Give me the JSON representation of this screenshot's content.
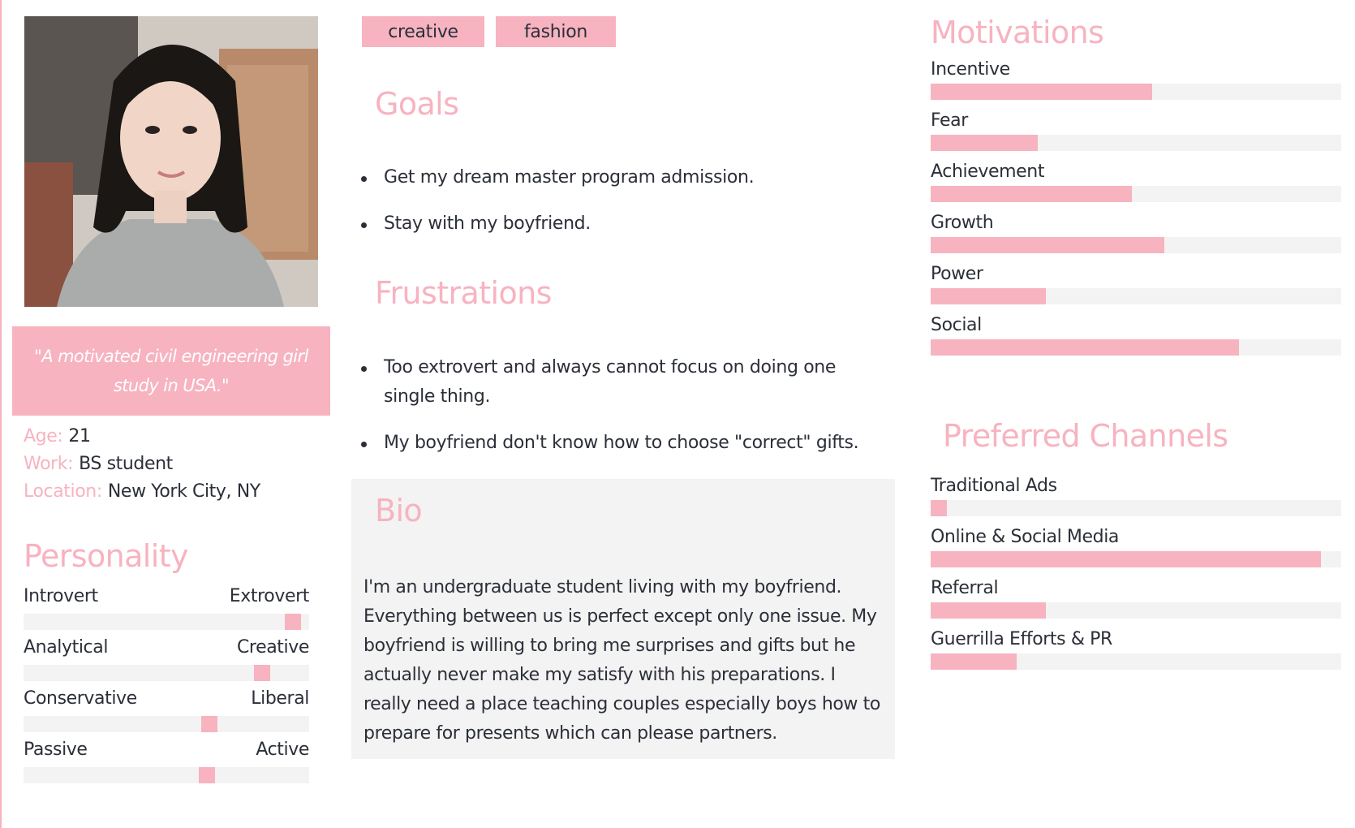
{
  "accent_color": "#f7b3c0",
  "profile": {
    "quote": "\"A motivated civil engineering girl study in USA.\"",
    "age_label": "Age:",
    "age": "21",
    "work_label": "Work:",
    "work": "BS student",
    "location_label": "Location:",
    "location": "New York City, NY"
  },
  "personality": {
    "heading": "Personality",
    "traits": [
      {
        "left": "Introvert",
        "right": "Extrovert",
        "value": 0.97
      },
      {
        "left": "Analytical",
        "right": "Creative",
        "value": 0.855
      },
      {
        "left": "Conservative",
        "right": "Liberal",
        "value": 0.66
      },
      {
        "left": "Passive",
        "right": "Active",
        "value": 0.65
      }
    ]
  },
  "tags": [
    "creative",
    "fashion"
  ],
  "goals": {
    "heading": "Goals",
    "items": [
      "Get my dream master program admission.",
      "Stay with my boyfriend."
    ]
  },
  "frustrations": {
    "heading": "Frustrations",
    "items": [
      "Too extrovert and always cannot focus on doing one single thing.",
      "My boyfriend don't know how to choose \"correct\" gifts."
    ]
  },
  "bio": {
    "heading": "Bio",
    "text": "I'm an undergraduate student living with my boyfriend. Everything between us is perfect except only one issue. My boyfriend is willing to bring me surprises and gifts but he actually never make my satisfy with his preparations. I really need a place teaching couples especially boys how to prepare for presents which can please partners."
  },
  "motivations": {
    "heading": "Motivations",
    "items": [
      {
        "label": "Incentive",
        "value": 0.54
      },
      {
        "label": "Fear",
        "value": 0.26
      },
      {
        "label": "Achievement",
        "value": 0.49
      },
      {
        "label": "Growth",
        "value": 0.57
      },
      {
        "label": "Power",
        "value": 0.28
      },
      {
        "label": "Social",
        "value": 0.75
      }
    ]
  },
  "channels": {
    "heading": "Preferred Channels",
    "items": [
      {
        "label": "Traditional Ads",
        "value": 0.04
      },
      {
        "label": "Online & Social Media",
        "value": 0.95
      },
      {
        "label": "Referral",
        "value": 0.28
      },
      {
        "label": "Guerrilla Efforts & PR",
        "value": 0.21
      }
    ]
  }
}
